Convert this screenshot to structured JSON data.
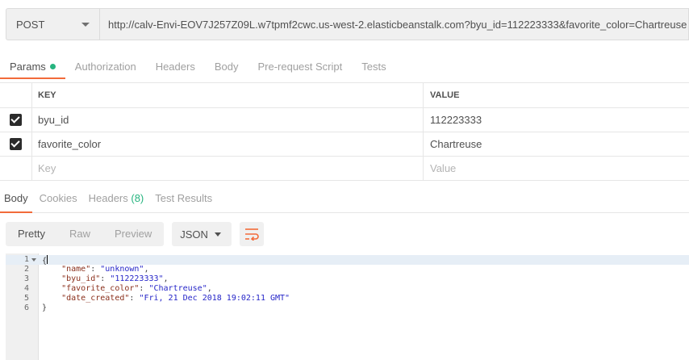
{
  "request": {
    "method": "POST",
    "url": "http://calv-Envi-EOV7J257Z09L.w7tpmf2cwc.us-west-2.elasticbeanstalk.com?byu_id=112223333&favorite_color=Chartreuse"
  },
  "request_tabs": [
    {
      "label": "Params",
      "active": true
    },
    {
      "label": "Authorization"
    },
    {
      "label": "Headers"
    },
    {
      "label": "Body"
    },
    {
      "label": "Pre-request Script"
    },
    {
      "label": "Tests"
    }
  ],
  "params": {
    "header": {
      "key": "KEY",
      "value": "VALUE"
    },
    "rows": [
      {
        "key": "byu_id",
        "value": "112223333",
        "checked": true
      },
      {
        "key": "favorite_color",
        "value": "Chartreuse",
        "checked": true
      }
    ],
    "placeholder": {
      "key": "Key",
      "value": "Value"
    }
  },
  "response_tabs": [
    {
      "label": "Body",
      "active": true
    },
    {
      "label": "Cookies"
    },
    {
      "label": "Headers",
      "count": "(8)"
    },
    {
      "label": "Test Results"
    }
  ],
  "toolbar": {
    "views": [
      "Pretty",
      "Raw",
      "Preview"
    ],
    "format": "JSON"
  },
  "response_body": {
    "open": "{",
    "close": "}",
    "entries": [
      {
        "key": "\"name\"",
        "value": "\"unknown\"",
        "comma": ","
      },
      {
        "key": "\"byu_id\"",
        "value": "\"112223333\"",
        "comma": ","
      },
      {
        "key": "\"favorite_color\"",
        "value": "\"Chartreuse\"",
        "comma": ","
      },
      {
        "key": "\"date_created\"",
        "value": "\"Fri, 21 Dec 2018 19:02:11 GMT\"",
        "comma": ""
      }
    ],
    "line_numbers": [
      "1",
      "2",
      "3",
      "4",
      "5",
      "6"
    ]
  },
  "colors": {
    "accent": "#f26b3a",
    "status_green": "#26b47f"
  },
  "icons": [
    "dropdown-caret-icon",
    "checkbox-checked-icon",
    "wrap-lines-icon",
    "fold-arrow-icon"
  ]
}
